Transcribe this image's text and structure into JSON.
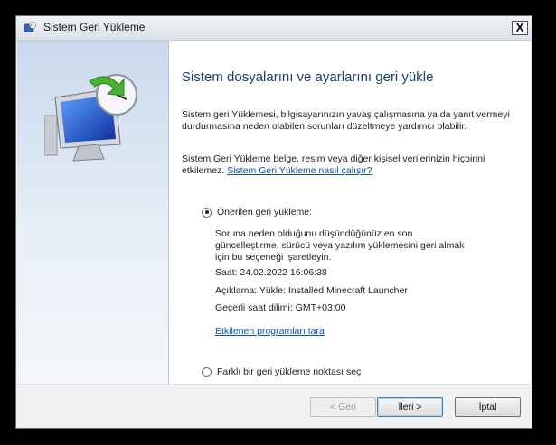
{
  "window": {
    "title": "Sistem Geri Yükleme",
    "close_label": "X"
  },
  "main": {
    "heading": "Sistem dosyalarını ve ayarlarını geri yükle",
    "intro": "Sistem geri Yüklemesi, bilgisayarınızın yavaş çalışmasına ya da yanıt vermeyi durdurmasına neden olabilen sorunları düzeltmeye yardımcı olabilir.",
    "note_prefix": "Sistem Geri Yükleme belge, resim veya diğer kişisel verilerinizin hiçbirini etkilemez.",
    "help_link": "Sistem Geri Yükleme nasıl çalışır?",
    "option_recommended": {
      "label": "Önerilen geri yükleme:",
      "selected": true,
      "description": "Soruna neden olduğunu düşündüğünüz en son güncelleştirme, sürücü veya yazılım yüklemesini geri almak için bu seçeneği işaretleyin.",
      "time": "Saat: 24.02.2022 16:06:38",
      "description_line": "Açıklama: Yükle: Installed Minecraft Launcher",
      "timezone": "Geçerli saat dilimi: GMT+03:00",
      "scan_link": "Etkilenen programları tara"
    },
    "option_other": {
      "label": "Farklı bir geri yükleme noktası seç",
      "selected": false
    }
  },
  "footer": {
    "back_label": "< Geri",
    "next_label": "İleri >",
    "cancel_label": "İptal"
  }
}
